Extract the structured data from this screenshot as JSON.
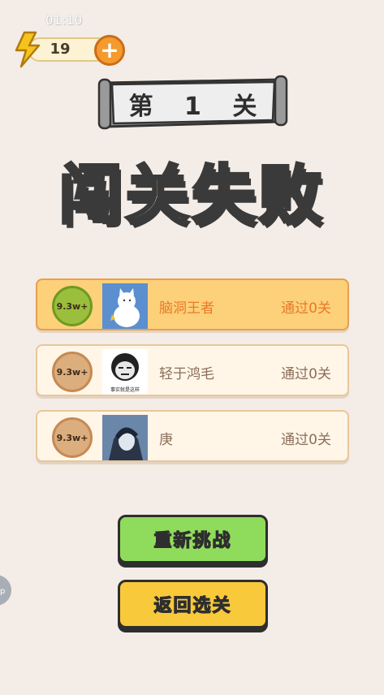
{
  "status": {
    "timer": "01:10"
  },
  "energy": {
    "count": "19",
    "add_symbol": "+"
  },
  "level": {
    "title": "第 1 关"
  },
  "result": {
    "title": "闯关失败"
  },
  "ranking": [
    {
      "score": "9.3w+",
      "name": "脑洞王者",
      "status": "通过0关",
      "avatar": "cat-avatar",
      "highlight": true
    },
    {
      "score": "9.3w+",
      "name": "轻于鸿毛",
      "status": "通过0关",
      "avatar": "meme-avatar",
      "avatar_caption": "事实就是这样",
      "highlight": false
    },
    {
      "score": "9.3w+",
      "name": "庚",
      "status": "通过0关",
      "avatar": "anime-boy-avatar",
      "highlight": false
    }
  ],
  "buttons": {
    "retry": "重新挑战",
    "back": "返回选关"
  },
  "colors": {
    "background": "#f4ece6",
    "retry": "#8fdc5c",
    "back": "#f8c93a",
    "highlight_row": "#fdd07a",
    "accent": "#f59a2e"
  }
}
